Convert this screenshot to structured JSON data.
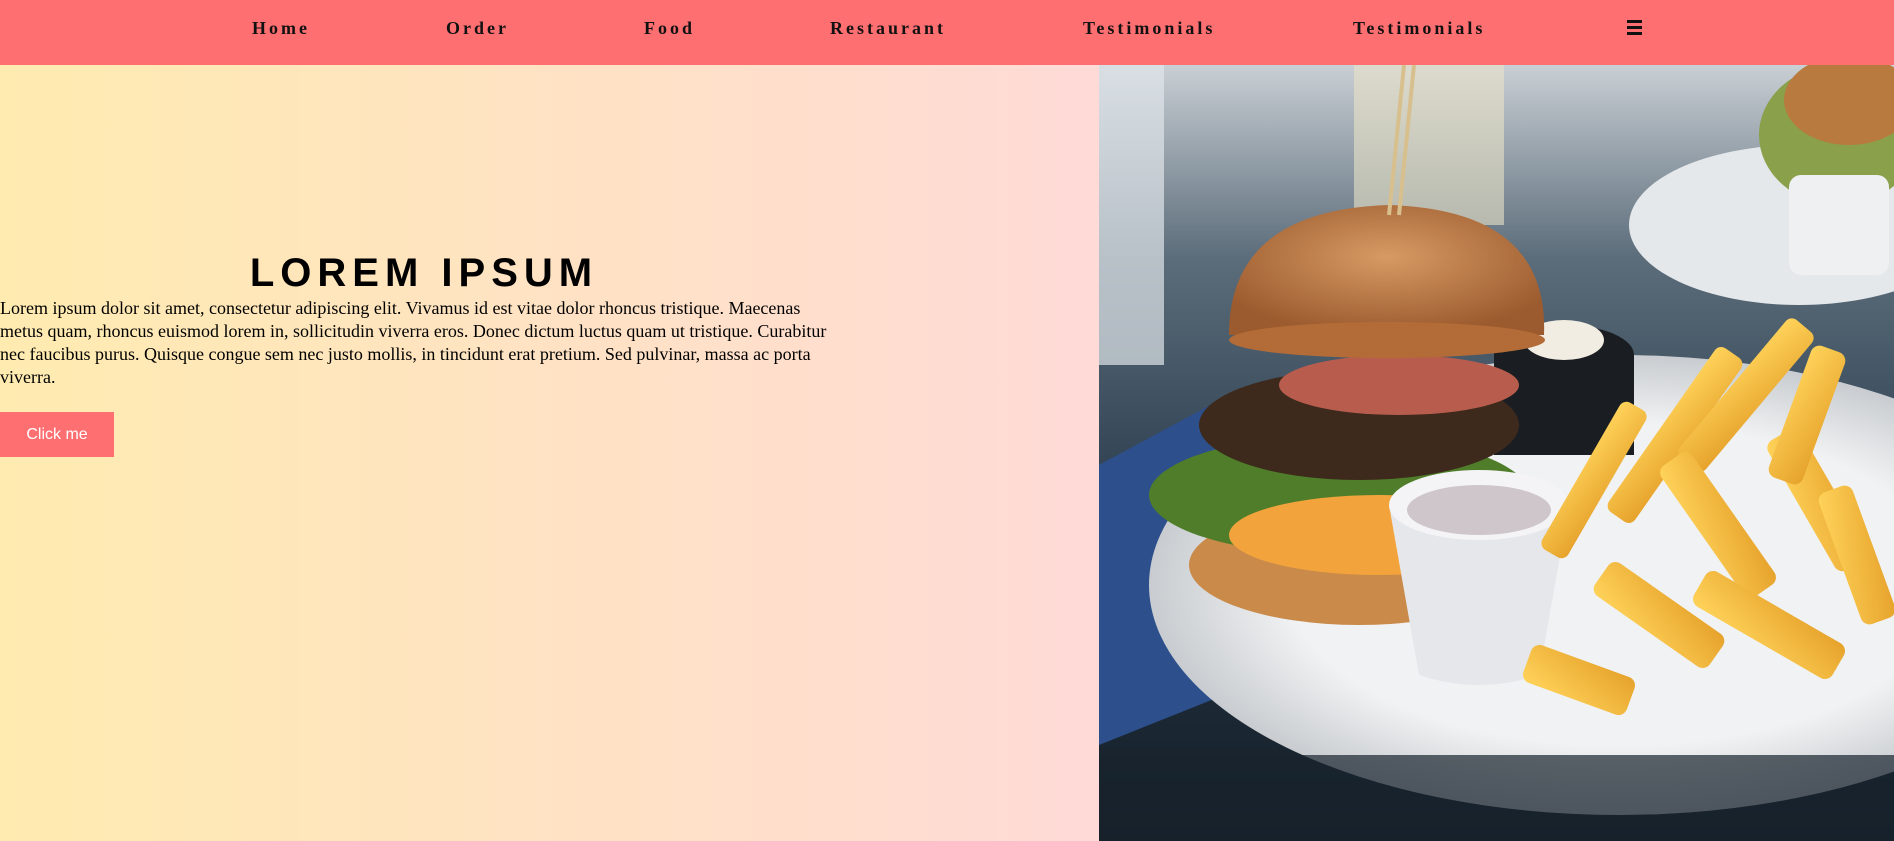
{
  "nav": {
    "items": [
      "Home",
      "Order",
      "Food",
      "Restaurant",
      "Testimonials",
      "Testimonials"
    ],
    "menu_icon": "hamburger-icon"
  },
  "hero": {
    "title": "LOREM IPSUM",
    "text": "Lorem ipsum dolor sit amet, consectetur adipiscing elit. Vivamus id est vitae dolor rhoncus tristique. Maecenas metus quam, rhoncus euismod lorem in, sollicitudin viverra eros. Donec dictum luctus quam ut tristique. Curabitur nec faucibus purus. Quisque congue sem nec justo mollis, in tincidunt erat pretium. Sed pulvinar, massa ac porta viverra.",
    "button_label": "Click me"
  },
  "colors": {
    "nav_bg": "#fe6f72",
    "gradient_start": "#ffebb0",
    "gradient_end": "#ffdad7",
    "button_bg": "#fe6f72"
  }
}
